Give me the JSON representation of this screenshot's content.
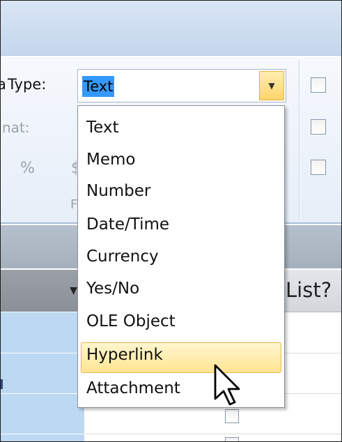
{
  "ribbon": {
    "data_type_label": "Type:",
    "data_type_prefix": "a",
    "format_label": "nat:",
    "percent_symbol": "%",
    "currency_glyph": "$",
    "group_label_partial": "F"
  },
  "combo": {
    "selected_value": "Text"
  },
  "dropdown": {
    "options": [
      "Text",
      "Memo",
      "Number",
      "Date/Time",
      "Currency",
      "Yes/No",
      "OLE Object",
      "Hyperlink",
      "Attachment"
    ],
    "hovered": "Hyperlink"
  },
  "datasheet": {
    "column_header_partial": "List?"
  },
  "colors": {
    "accent_selection": "#3399ff",
    "hover_fill": "#ffe592",
    "hover_border": "#e6b84a"
  },
  "icons": {
    "dropdown_arrow": "chevron-down-icon",
    "cursor": "mouse-pointer-icon"
  }
}
